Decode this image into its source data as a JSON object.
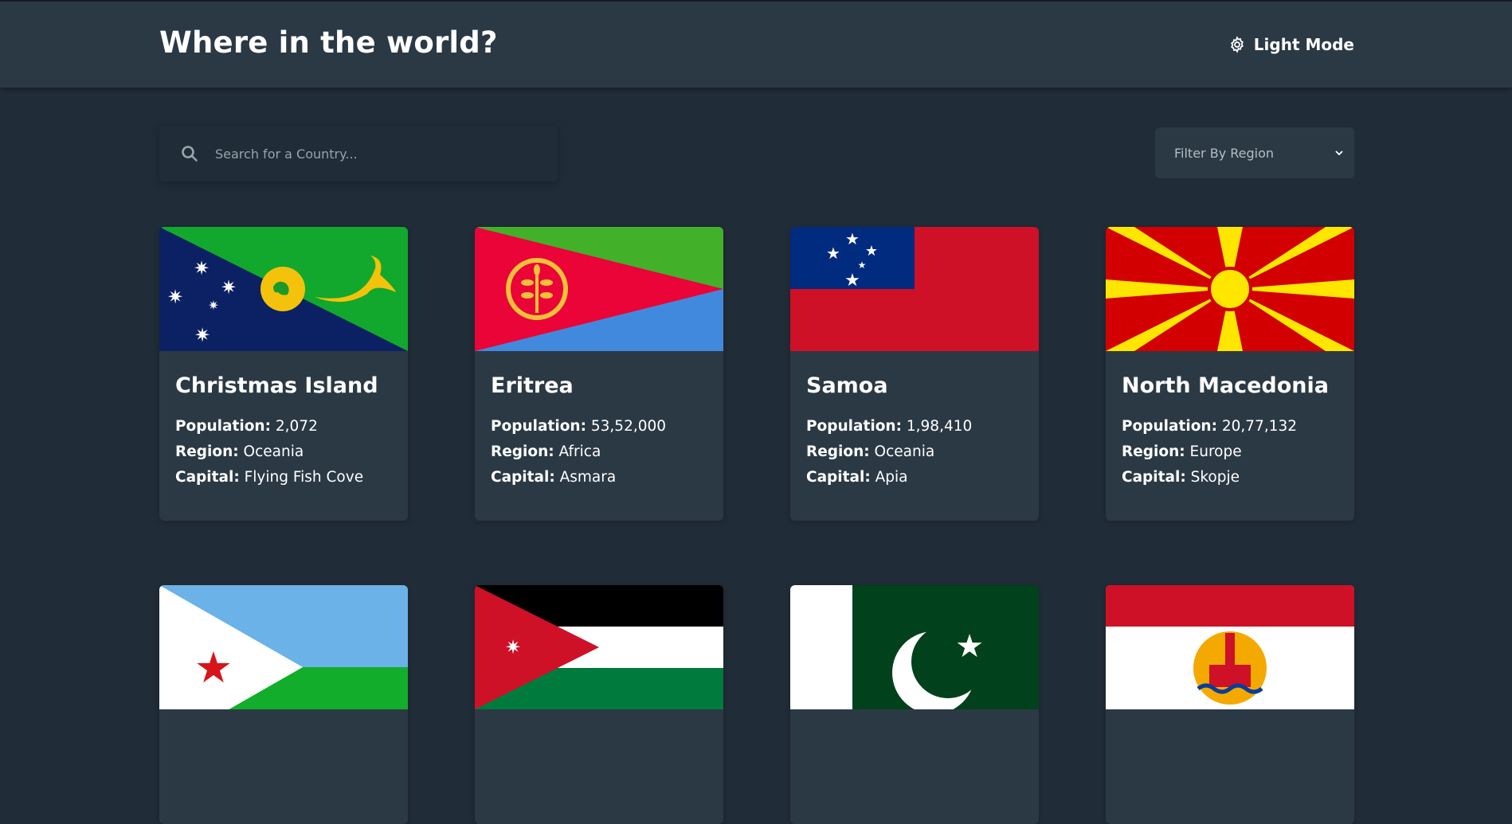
{
  "header": {
    "title": "Where in the world?",
    "mode_label": "Light Mode"
  },
  "search": {
    "placeholder": "Search for a Country..."
  },
  "filter": {
    "label": "Filter By Region"
  },
  "labels": {
    "population": "Population:",
    "region": "Region:",
    "capital": "Capital:"
  },
  "countries": [
    {
      "name": "Christmas Island",
      "population": "2,072",
      "region": "Oceania",
      "capital": "Flying Fish Cove",
      "flag": "christmas-island-flag"
    },
    {
      "name": "Eritrea",
      "population": "53,52,000",
      "region": "Africa",
      "capital": "Asmara",
      "flag": "eritrea-flag"
    },
    {
      "name": "Samoa",
      "population": "1,98,410",
      "region": "Oceania",
      "capital": "Apia",
      "flag": "samoa-flag"
    },
    {
      "name": "North Macedonia",
      "population": "20,77,132",
      "region": "Europe",
      "capital": "Skopje",
      "flag": "north-macedonia-flag"
    }
  ],
  "partial_cards": [
    {
      "flag": "djibouti-flag"
    },
    {
      "flag": "jordan-flag"
    },
    {
      "flag": "pakistan-flag"
    },
    {
      "flag": "french-polynesia-flag"
    }
  ],
  "colors": {
    "background": "#202c37",
    "element": "#2b3945",
    "text": "#ffffff",
    "muted": "#9aa3ab"
  }
}
